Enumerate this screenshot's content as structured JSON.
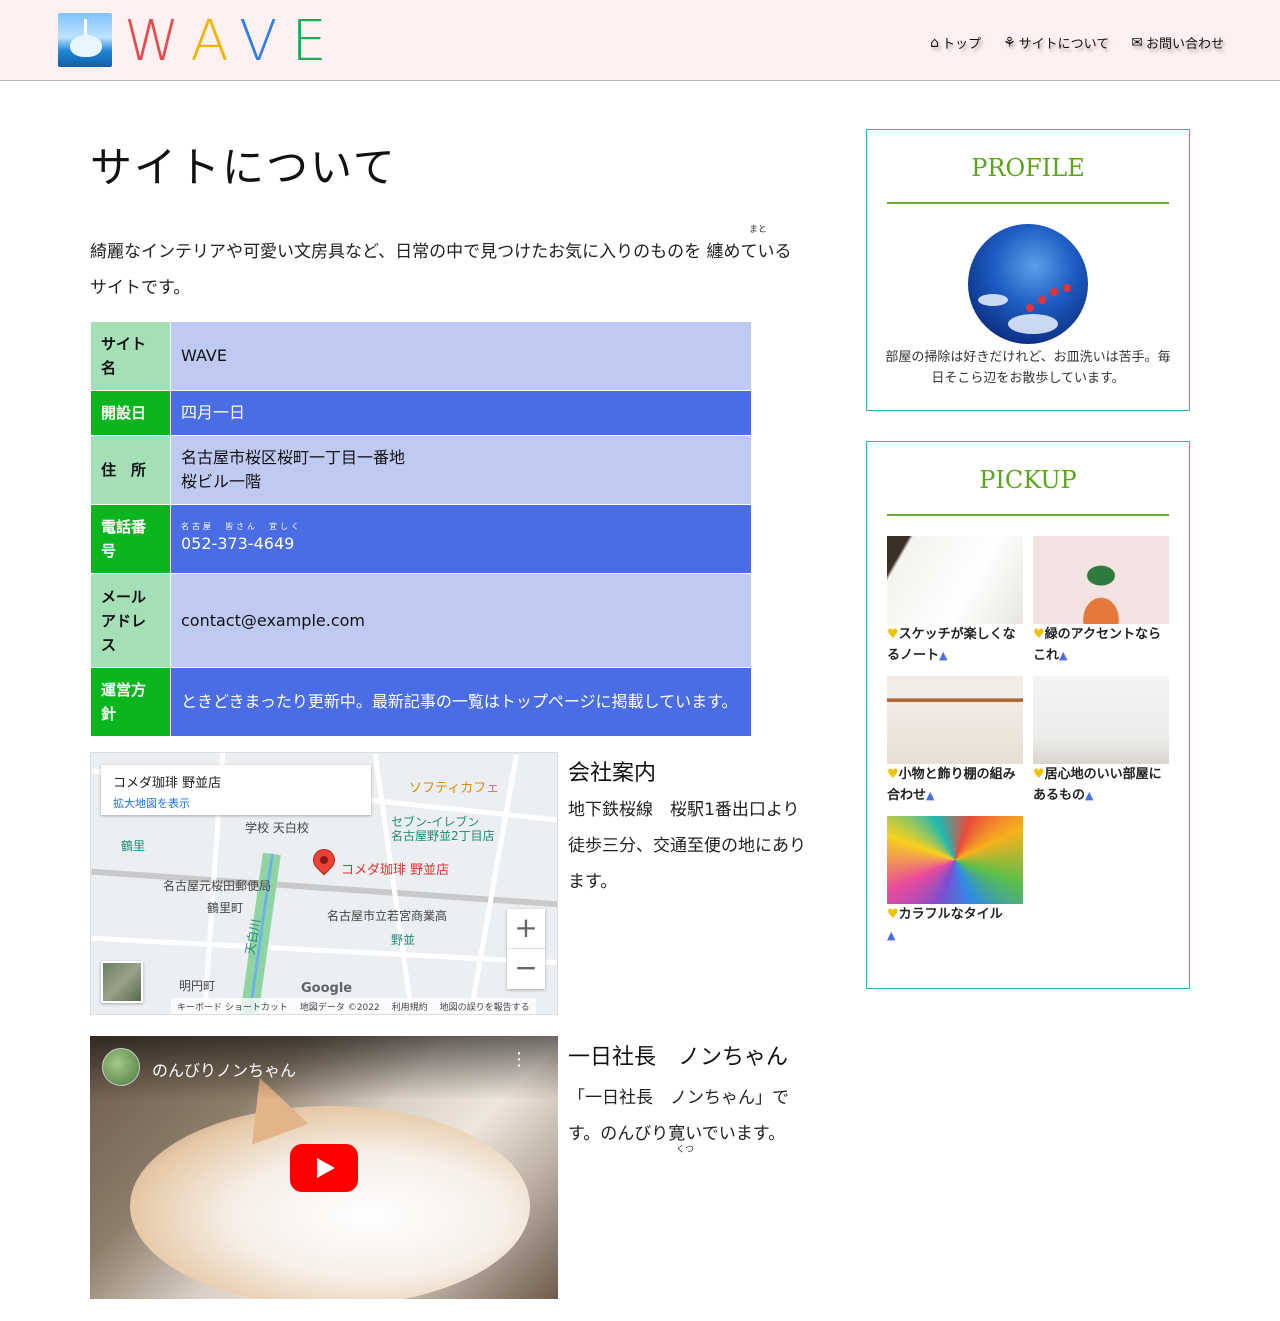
{
  "header": {
    "logo_text": [
      "W",
      "A",
      "V",
      "E"
    ],
    "nav": [
      {
        "icon": "home-icon",
        "glyph": "⌂",
        "label": "トップ"
      },
      {
        "icon": "leaf-icon",
        "glyph": "⚘",
        "label": "サイトについて"
      },
      {
        "icon": "mail-icon",
        "glyph": "✉",
        "label": "お問い合わせ"
      }
    ]
  },
  "main": {
    "title": "サイトについて",
    "intro": "綺麗なインテリアや可愛い文房具など、日常の中で見つけたお気に入りのものを 纏めているサイトです。",
    "intro_ruby": "まと",
    "table": [
      {
        "label": "サイト名",
        "value": "WAVE"
      },
      {
        "label": "開設日",
        "value": "四月一日"
      },
      {
        "label": "住　所",
        "value": "名古屋市桜区桜町一丁目一番地",
        "value2": "桜ビル一階"
      },
      {
        "label": "電話番号",
        "ruby": "名古屋　皆さん　宜しく",
        "value": "052-373-4649"
      },
      {
        "label": "メールアドレス",
        "value": "contact@example.com"
      },
      {
        "label": "運営方針",
        "value": "ときどきまったり更新中。最新記事の一覧はトップページに掲載しています。"
      }
    ],
    "map": {
      "place_name": "コメダ珈琲 野並店",
      "enlarge_link": "拡大地図を表示",
      "labels": {
        "softy": "ソフティカフェ",
        "seven": "セブン-イレブン",
        "seven2": "名古屋野並2丁目店",
        "school": "学校 天白校",
        "tsurusato": "鶴里",
        "pin": "コメダ珈琲 野並店",
        "post": "名古屋元桜田郵便局",
        "tsurusatocho": "鶴里町",
        "hs": "名古屋市立若宮商業高",
        "nonami": "野並",
        "meienmachi": "明円町",
        "tenpaku": "天白川"
      },
      "zoom_in": "+",
      "zoom_out": "−",
      "google": "Google",
      "footer": [
        "キーボード ショートカット",
        "地図データ ©2022",
        "利用規約",
        "地図の誤りを報告する"
      ]
    },
    "company": {
      "title": "会社案内",
      "text": "地下鉄桜線　桜駅1番出口より徒歩三分、交通至便の地にあります。"
    },
    "video": {
      "channel": "のんびりノンちゃん",
      "menu": "⋮"
    },
    "president": {
      "title": "一日社長　ノンちゃん",
      "text": "「一日社長　ノンちゃん」です。のんびり寛いでいます。",
      "ruby": "くつ"
    }
  },
  "sidebar": {
    "profile": {
      "title": "PROFILE",
      "text": "部屋の掃除は好きだけれど、お皿洗いは苦手。毎日そこら辺をお散歩しています。"
    },
    "pickup": {
      "title": "PICKUP",
      "items": [
        {
          "caption": "スケッチが楽しくなるノート"
        },
        {
          "caption": "緑のアクセントならこれ"
        },
        {
          "caption": "小物と飾り棚の組み合わせ"
        },
        {
          "caption": "居心地のいい部屋にあるもの"
        },
        {
          "caption": "カラフルなタイル"
        }
      ]
    }
  },
  "colors": {
    "header_bg": "#fff1f1",
    "accent_green": "#5aa51a",
    "table_green": "#0ab51f",
    "table_blue": "#4a6de4",
    "table_light": "#bfcaf3",
    "widget_border": "#3fa8c9"
  }
}
